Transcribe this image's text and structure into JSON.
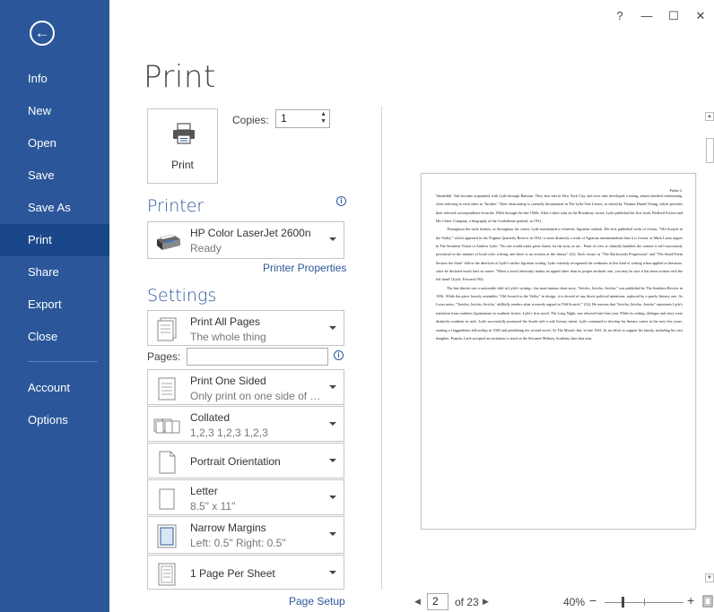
{
  "window": {
    "help": "?",
    "minimize": "—",
    "maximize": "☐",
    "close": "✕"
  },
  "sidebar": {
    "back_icon": "←",
    "items": [
      {
        "label": "Info"
      },
      {
        "label": "New"
      },
      {
        "label": "Open"
      },
      {
        "label": "Save"
      },
      {
        "label": "Save As"
      },
      {
        "label": "Print",
        "selected": true
      },
      {
        "label": "Share"
      },
      {
        "label": "Export"
      },
      {
        "label": "Close"
      },
      {
        "label": "Account"
      },
      {
        "label": "Options"
      }
    ]
  },
  "print": {
    "title": "Print",
    "print_button_label": "Print",
    "copies_label": "Copies:",
    "copies_value": "1",
    "printer_heading": "Printer",
    "printer_name": "HP Color LaserJet 2600n",
    "printer_status": "Ready",
    "printer_properties": "Printer Properties",
    "settings_heading": "Settings",
    "pages_label": "Pages:",
    "pages_value": "",
    "page_setup": "Page Setup",
    "settings": [
      {
        "main": "Print All Pages",
        "sub": "The whole thing",
        "icon": "pages-icon"
      },
      {
        "main": "Print One Sided",
        "sub": "Only print on one side of th...",
        "icon": "one-sided-icon"
      },
      {
        "main": "Collated",
        "sub": "1,2,3   1,2,3   1,2,3",
        "icon": "collated-icon"
      },
      {
        "main": "Portrait Orientation",
        "sub": "",
        "icon": "portrait-icon"
      },
      {
        "main": "Letter",
        "sub": "8.5\" x 11\"",
        "icon": "paper-size-icon"
      },
      {
        "main": "Narrow Margins",
        "sub": "Left: 0.5\"   Right: 0.5\"",
        "icon": "margins-icon"
      },
      {
        "main": "1 Page Per Sheet",
        "sub": "",
        "icon": "pages-per-sheet-icon"
      }
    ]
  },
  "preview": {
    "header": "Parker 2",
    "paragraphs": [
      "Vanderbilt. Tate became acquainted with Lytle through Ransom. They first met in New York City, and over time developed a strong, almost kindred relationship, often referring to each other as \"brother.\" Their relationship is carefully documented in The Lytle-Tate Letters, as edited by Thomas Daniel Young, which provides their selected correspondence from the 1920s through the late 1960s. After a short stint on the Broadway circuit, Lytle published his first book, Bedford Forrest and His Critter Company, a biography of the Confederate general, in 1931.",
      "Throughout the early thirties, as throughout his career, Lytle maintained a relatively Agrarian outlook. His first published work of fiction, \"Old Scratch in the Valley,\" which appeared in the Virginia Quarterly Review in 1932, is more distinctly a work of Agrarian sentimentalism than it is fiction, as Mark Lucas argues in The Southern Vision of Andrew Lytle: \"No one would make great claims for the story as art... Point of view is clumsily handled; the content is self-consciously provincial in the manner of local-color writing; and there is an evasion at the climax\" (52). Such essays as \"The Backwoods Progression\" and \"The Small Farm Secures the State\" follow the direction of Lytle's earlier Agrarian writing. Lytle certainly recognized the weakness in this kind of writing when applied to literature, since he declared much later in career: \"When a novel obviously makes an appeal other than its proper aesthetic one, you may be sure it has been written with the left hand\" (Lytle, Forward 194).",
      "The late thirties saw a noticeable shift in Lytle's writing—his most famous short story, \"Jericho, Jericho, Jericho,\" was published by The Southern Review in 1936. While the piece loosely resembles \"Old Scratch in the Valley\" in design, it is devoid of any direct political intentions, replaced by a purely literary one. As Lucas notes, \"'Jericho, Jericho, Jericho,' skillfully renders what is merely argued in 'Old Scratch,'\" (52). He reasons that \"Jericho, Jericho, Jericho\" represents Lytle's transition from southern Agrarianism to southern fiction. Lytle's first novel, The Long Night, was released later that year. While its setting, dialogue and story were distinctly southern in style, Lytle successfully portrayed the South with a sole literary intent. Lytle continued to develop his literary career in the next five years, earning a Guggenheim fellowship in 1940 and publishing his second novel, At The Moon's Inn, in late 1941. In an effort to support his family, including his first daughter, Pamela, Lytle accepted an invitation to teach at the Sewanee Military Academy later that year."
    ]
  },
  "navigation": {
    "prev_icon": "◀",
    "current_page": "2",
    "of_text": "of 23",
    "next_icon": "▶",
    "zoom_label": "40%",
    "zoom_level": 0.4,
    "zoom_minus": "−",
    "zoom_plus": "+"
  }
}
